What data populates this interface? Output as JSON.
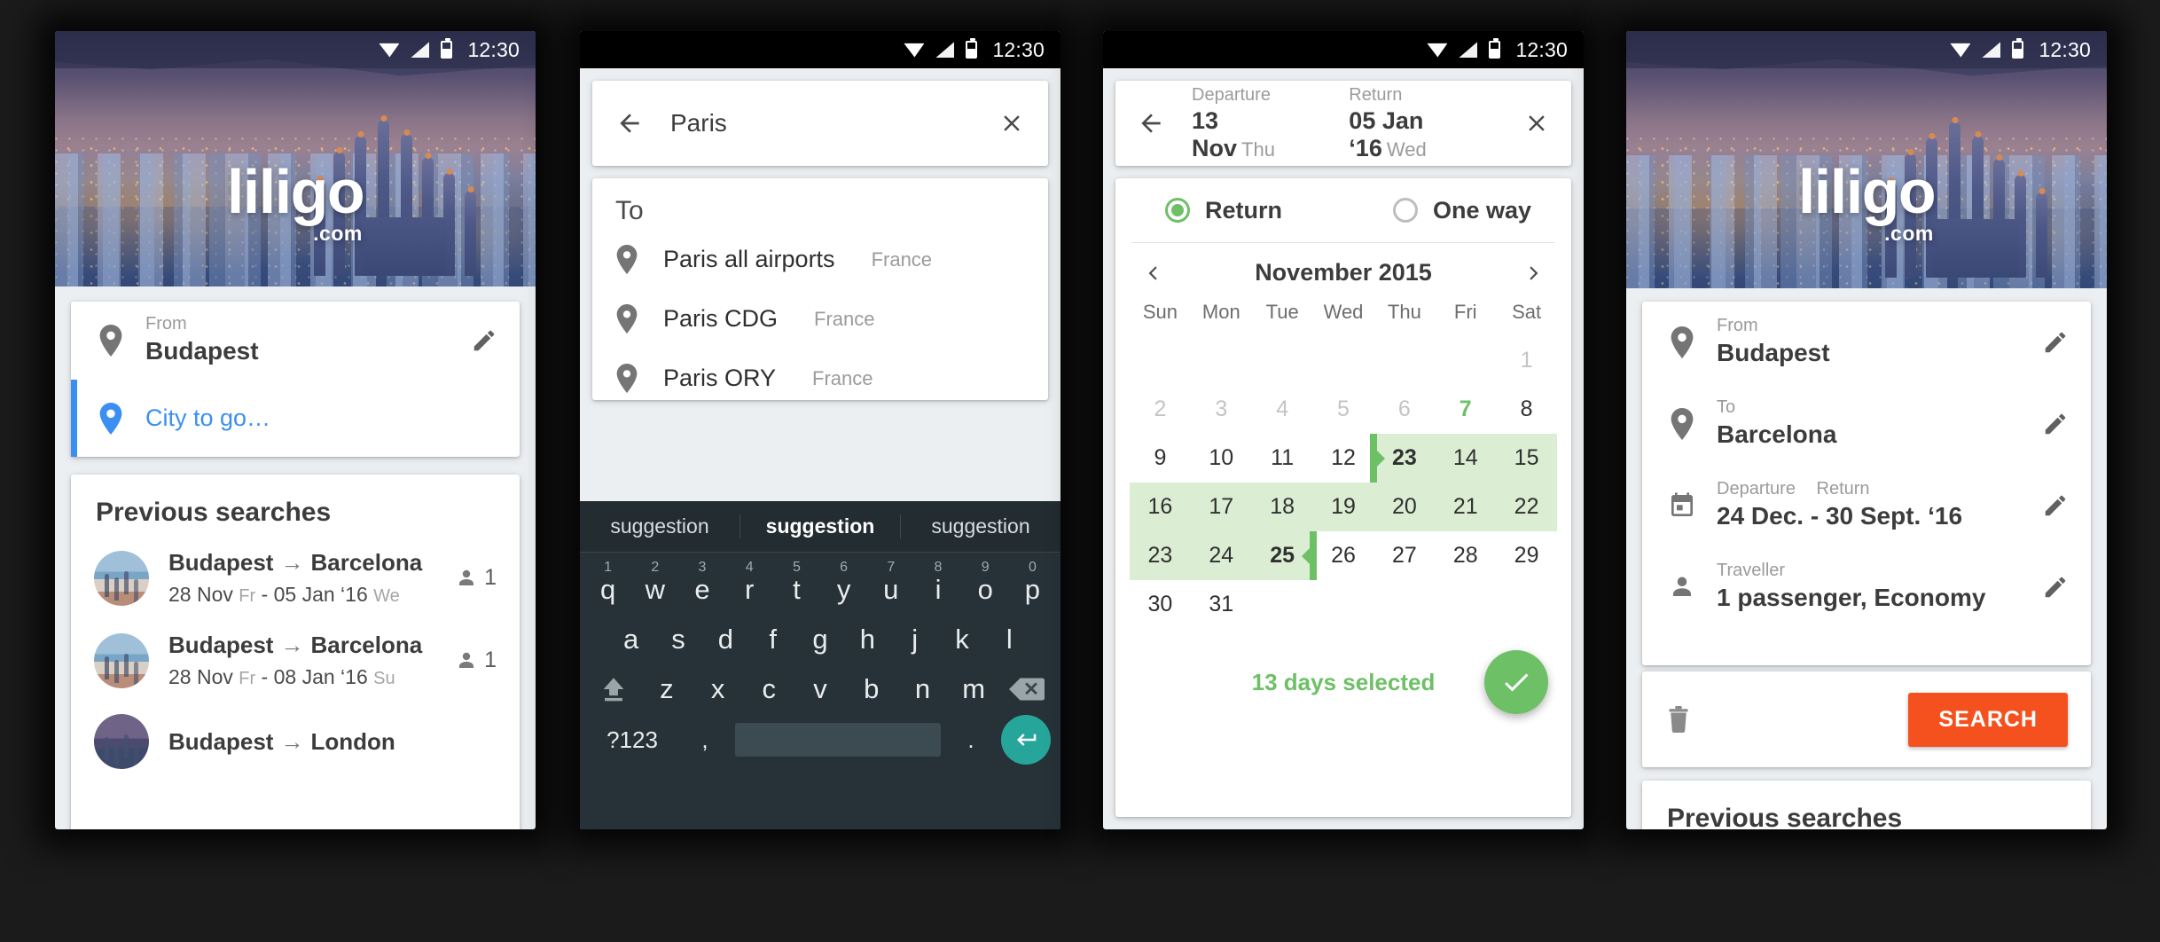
{
  "status_bar": {
    "time": "12:30",
    "icons": [
      "wifi-icon",
      "signal-icon",
      "battery-icon"
    ]
  },
  "brand": {
    "wordmark": "liligo",
    "dotcom": ".com",
    "accent": "#3b8ff0",
    "cta": "#f4511e",
    "green": "#6ec067"
  },
  "phone1": {
    "form": {
      "from": {
        "label": "From",
        "value": "Budapest",
        "edit": "edit-icon"
      },
      "to": {
        "placeholder": "City to go…"
      }
    },
    "previous": {
      "title": "Previous searches",
      "rows": [
        {
          "origin": "Budapest",
          "arrow": "→",
          "destination": "Barcelona",
          "depart": "28 Nov",
          "depart_dow": "Fr",
          "sep": "-",
          "ret": "05 Jan ‘16",
          "ret_dow": "We",
          "pax": "1"
        },
        {
          "origin": "Budapest",
          "arrow": "→",
          "destination": "Barcelona",
          "depart": "28 Nov",
          "depart_dow": "Fr",
          "sep": "-",
          "ret": "08 Jan ‘16",
          "ret_dow": "Su",
          "pax": "1"
        },
        {
          "origin": "Budapest",
          "arrow": "→",
          "destination": "London",
          "depart": "",
          "depart_dow": "",
          "sep": "",
          "ret": "",
          "ret_dow": "",
          "pax": ""
        }
      ]
    }
  },
  "phone2": {
    "search": {
      "back": "back-arrow-icon",
      "query": "Paris",
      "placeholder": "City to go…",
      "clear": "close-icon"
    },
    "suggestions": {
      "title": "To",
      "items": [
        {
          "name": "Paris all airports",
          "country": "France"
        },
        {
          "name": "Paris CDG",
          "country": "France"
        },
        {
          "name": "Paris ORY",
          "country": "France"
        }
      ]
    },
    "keyboard": {
      "suggestions": [
        "suggestion",
        "suggestion",
        "suggestion"
      ],
      "active_suggestion_index": 1,
      "row1": [
        {
          "k": "q",
          "n": "1"
        },
        {
          "k": "w",
          "n": "2"
        },
        {
          "k": "e",
          "n": "3"
        },
        {
          "k": "r",
          "n": "4"
        },
        {
          "k": "t",
          "n": "5"
        },
        {
          "k": "y",
          "n": "6"
        },
        {
          "k": "u",
          "n": "7"
        },
        {
          "k": "i",
          "n": "8"
        },
        {
          "k": "o",
          "n": "9"
        },
        {
          "k": "p",
          "n": "0"
        }
      ],
      "row2": [
        "a",
        "s",
        "d",
        "f",
        "g",
        "h",
        "j",
        "k",
        "l"
      ],
      "row3": [
        "z",
        "x",
        "c",
        "v",
        "b",
        "n",
        "m"
      ],
      "shift": "shift-icon",
      "delete": "backspace-icon",
      "numbers": "?123",
      "comma": ",",
      "period": ".",
      "enter": "enter-icon"
    }
  },
  "phone3": {
    "header": {
      "back": "back-arrow-icon",
      "departure_label": "Departure",
      "departure_value": "13 Nov",
      "departure_dow": "Thu",
      "return_label": "Return",
      "return_value": "05 Jan ‘16",
      "return_dow": "Wed",
      "close": "close-icon"
    },
    "trip_type": {
      "options": [
        "Return",
        "One way"
      ],
      "selected": "Return"
    },
    "calendar": {
      "prev": "chevron-left-icon",
      "next": "chevron-right-icon",
      "month": "November 2015",
      "weekdays": [
        "Sun",
        "Mon",
        "Tue",
        "Wed",
        "Thu",
        "Fri",
        "Sat"
      ],
      "weeks": [
        [
          {
            "d": "",
            "s": "empty"
          },
          {
            "d": "",
            "s": "empty"
          },
          {
            "d": "",
            "s": "empty"
          },
          {
            "d": "",
            "s": "empty"
          },
          {
            "d": "",
            "s": "empty"
          },
          {
            "d": "",
            "s": "empty"
          },
          {
            "d": "1",
            "s": "dim"
          }
        ],
        [
          {
            "d": "2",
            "s": "dim"
          },
          {
            "d": "3",
            "s": "dim"
          },
          {
            "d": "4",
            "s": "dim"
          },
          {
            "d": "5",
            "s": "dim"
          },
          {
            "d": "6",
            "s": "dim"
          },
          {
            "d": "7",
            "s": "today"
          },
          {
            "d": "8",
            "s": "normal"
          }
        ],
        [
          {
            "d": "9",
            "s": "normal"
          },
          {
            "d": "10",
            "s": "normal"
          },
          {
            "d": "11",
            "s": "normal"
          },
          {
            "d": "12",
            "s": "normal"
          },
          {
            "d": "23",
            "s": "range-start"
          },
          {
            "d": "14",
            "s": "in-range"
          },
          {
            "d": "15",
            "s": "in-range"
          }
        ],
        [
          {
            "d": "16",
            "s": "in-range"
          },
          {
            "d": "17",
            "s": "in-range"
          },
          {
            "d": "18",
            "s": "in-range"
          },
          {
            "d": "19",
            "s": "in-range"
          },
          {
            "d": "20",
            "s": "in-range"
          },
          {
            "d": "21",
            "s": "in-range"
          },
          {
            "d": "22",
            "s": "in-range"
          }
        ],
        [
          {
            "d": "23",
            "s": "in-range"
          },
          {
            "d": "24",
            "s": "in-range"
          },
          {
            "d": "25",
            "s": "range-end"
          },
          {
            "d": "26",
            "s": "normal"
          },
          {
            "d": "27",
            "s": "normal"
          },
          {
            "d": "28",
            "s": "normal"
          },
          {
            "d": "29",
            "s": "normal"
          }
        ],
        [
          {
            "d": "30",
            "s": "normal"
          },
          {
            "d": "31",
            "s": "normal"
          },
          {
            "d": "",
            "s": "empty"
          },
          {
            "d": "",
            "s": "empty"
          },
          {
            "d": "",
            "s": "empty"
          },
          {
            "d": "",
            "s": "empty"
          },
          {
            "d": "",
            "s": "empty"
          }
        ]
      ],
      "status": "13 days selected",
      "confirm": "check-icon"
    }
  },
  "phone4": {
    "form": {
      "from": {
        "label": "From",
        "value": "Budapest",
        "icon": "location-pin-icon",
        "edit": "edit-icon"
      },
      "to": {
        "label": "To",
        "value": "Barcelona",
        "icon": "location-pin-icon",
        "edit": "edit-icon"
      },
      "dates": {
        "label_departure": "Departure",
        "label_return": "Return",
        "value": "24 Dec. - 30 Sept. ‘16",
        "icon": "calendar-icon",
        "edit": "edit-icon"
      },
      "traveller": {
        "label": "Traveller",
        "value": "1 passenger, Economy",
        "icon": "person-icon",
        "edit": "edit-icon"
      }
    },
    "actions": {
      "delete": "trash-icon",
      "search_label": "SEARCH"
    },
    "previous": {
      "title": "Previous searches"
    }
  }
}
